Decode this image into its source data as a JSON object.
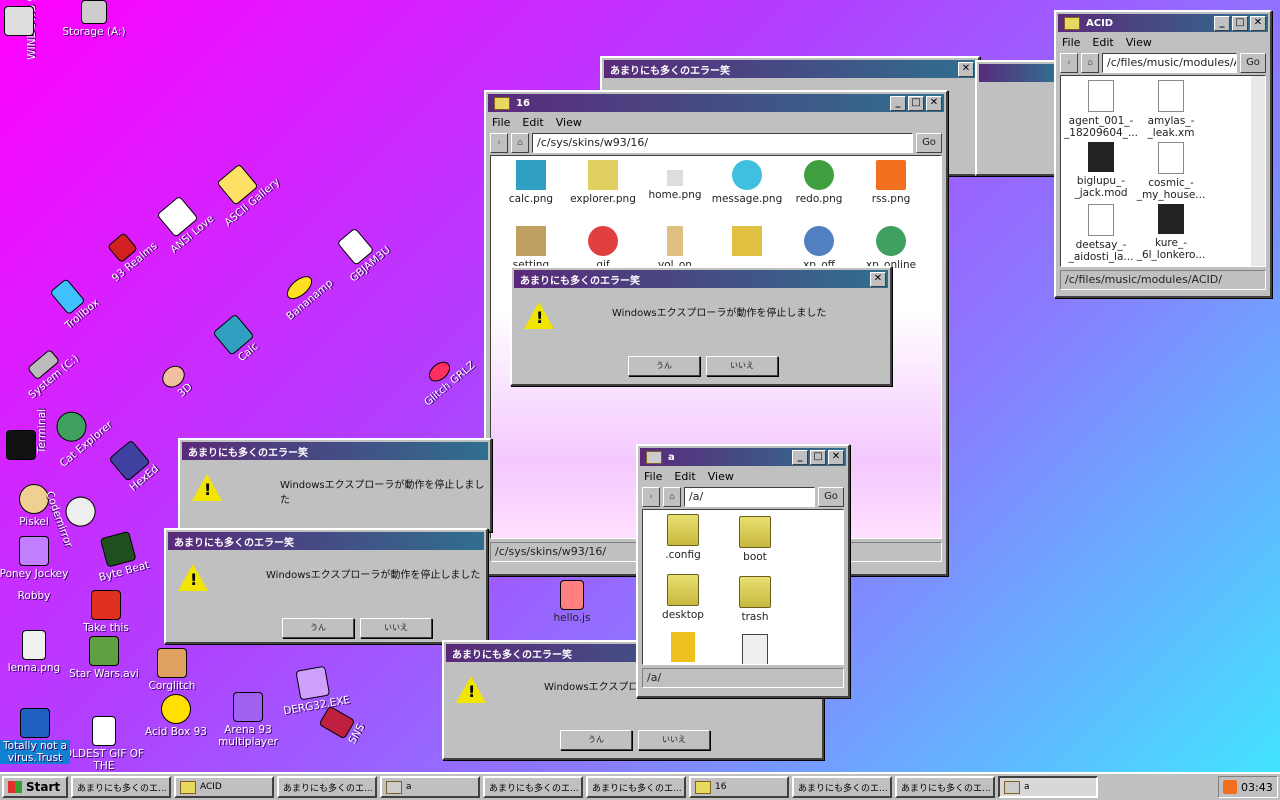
{
  "desktop": {
    "icons": [
      {
        "label": "WINDOWS 93",
        "icon": "windows-icon"
      },
      {
        "label": "Storage (A:)",
        "icon": "floppy-icon"
      },
      {
        "label": "ASCII Gallery",
        "icon": "ascii-icon"
      },
      {
        "label": "ANSI Love",
        "icon": "ansi-icon"
      },
      {
        "label": "93 Realms",
        "icon": "realms-icon"
      },
      {
        "label": "Trollbox",
        "icon": "trollbox-icon"
      },
      {
        "label": "GBJAM3U",
        "icon": "gameboy-icon"
      },
      {
        "label": "Bananamp",
        "icon": "banana-icon"
      },
      {
        "label": "Calc",
        "icon": "calc-icon"
      },
      {
        "label": "System (C:)",
        "icon": "drive-icon"
      },
      {
        "label": "3D",
        "icon": "teapot-icon"
      },
      {
        "label": "Cat Explorer",
        "icon": "cat-icon"
      },
      {
        "label": "Glitch GRLZ",
        "icon": "lips-icon"
      },
      {
        "label": "Terminal",
        "icon": "terminal-icon"
      },
      {
        "label": "HexEd",
        "icon": "hex-icon"
      },
      {
        "label": "Piskel",
        "icon": "palette-icon"
      },
      {
        "label": "Codemirror",
        "icon": "code-icon"
      },
      {
        "label": "Poney Jockey",
        "icon": "pony-icon"
      },
      {
        "label": "Byte Beat",
        "icon": "bytebeat-icon"
      },
      {
        "label": "Robby",
        "icon": "robot-icon"
      },
      {
        "label": "Take this",
        "icon": "mario-icon"
      },
      {
        "label": "lenna.png",
        "icon": "image-icon"
      },
      {
        "label": "Star Wars.avi",
        "icon": "yoda-icon"
      },
      {
        "label": "Corglitch",
        "icon": "corgi-icon"
      },
      {
        "label": "Acid Box 93",
        "icon": "smiley-icon"
      },
      {
        "label": "Arena 93 multiplayer",
        "icon": "arena-icon"
      },
      {
        "label": "DERG32.EXE",
        "icon": "derg-icon"
      },
      {
        "label": "SNS",
        "icon": "sns-icon"
      },
      {
        "label": "OLDEST GIF OF THE",
        "icon": "gif-icon"
      },
      {
        "label": "Totally not a virus.Trust",
        "icon": "virus-icon"
      },
      {
        "label": "hello.js",
        "icon": "js-file-icon"
      }
    ]
  },
  "error_title": "あまりにも多くのエラー笑",
  "error_message": "Windowsエクスプローラが動作を停止しました",
  "error_yes": "うん",
  "error_no": "いいえ",
  "window16": {
    "title": "16",
    "menu": [
      "File",
      "Edit",
      "View"
    ],
    "address": "/c/sys/skins/w93/16/",
    "go": "Go",
    "files": [
      "calc.png",
      "explorer.png",
      "home.png",
      "message.png",
      "redo.png",
      "rss.png",
      "setting",
      "gif",
      "vol_on",
      "",
      "xp_off",
      "xp_online"
    ],
    "status": "/c/sys/skins/w93/16/"
  },
  "windowA": {
    "title": "a",
    "menu": [
      "File",
      "Edit",
      "View"
    ],
    "address": "/a/",
    "go": "Go",
    "files": [
      ".config",
      "boot",
      "desktop",
      "trash",
      "",
      ""
    ],
    "status": "/a/"
  },
  "windowAcid": {
    "title": "ACID",
    "menu": [
      "File",
      "Edit",
      "View"
    ],
    "address": "/c/files/music/modules/A",
    "go": "Go",
    "files": [
      "agent_001_-_18209604_...",
      "amylas_-_leak.xm",
      "biglupu_-_jack.mod",
      "cosmic_-_my_house...",
      "deetsay_-_aidosti_la...",
      "kure_-_6l_lonkero..."
    ],
    "status": "/c/files/music/modules/ACID/"
  },
  "taskbar": {
    "start": "Start",
    "tasks": [
      "あまりにも多くのエ...",
      "ACID",
      "あまりにも多くのエ...",
      "a",
      "あまりにも多くのエ...",
      "あまりにも多くのエ...",
      "16",
      "あまりにも多くのエ...",
      "あまりにも多くのエ...",
      "a"
    ],
    "clock": "03:43"
  },
  "colors": {
    "titlebar_start": "#5a2a7a",
    "titlebar_end": "#2f6f8f",
    "face": "#c0c0c0"
  }
}
